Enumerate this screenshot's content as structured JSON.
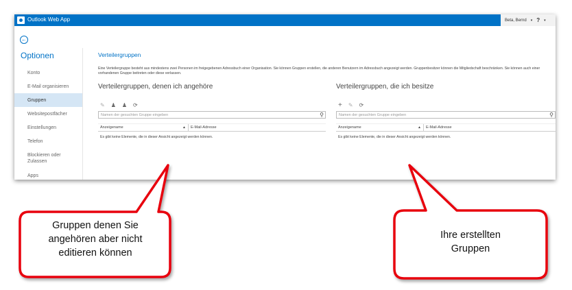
{
  "header": {
    "app_title": "Outlook Web App",
    "user_name": "Beta, Bernd",
    "user_caret": "▾",
    "help": "?",
    "help_caret": "▾"
  },
  "nav": {
    "back_icon": "back-arrow-icon",
    "title": "Optionen",
    "items": [
      {
        "label": "Konto"
      },
      {
        "label": "E-Mail organisieren"
      },
      {
        "label": "Gruppen"
      },
      {
        "label": "Websitepostfächer"
      },
      {
        "label": "Einstellungen"
      },
      {
        "label": "Telefon"
      },
      {
        "label": "Blockieren oder Zulassen"
      },
      {
        "label": "Apps"
      }
    ],
    "active": "Gruppen"
  },
  "content": {
    "title": "Verteilergruppen",
    "description": "Eine Verteilergruppe besteht aus mindestens zwei Personen im freigegebenen Adressbuch einer Organisation. Sie können Gruppen erstellen, die anderen Benutzern im Adressbuch angezeigt werden. Gruppenbesitzer können die Mitgliedschaft beschränken. Sie können auch einer vorhandenen Gruppe beitreten oder diese verlassen.",
    "member_section": {
      "title": "Verteilergruppen, denen ich angehöre",
      "search_placeholder": "Namen der gesuchten Gruppe eingeben",
      "col_display_name": "Anzeigename",
      "col_email": "E-Mail-Adresse",
      "empty_message": "Es gibt keine Elemente, die in dieser Ansicht angezeigt werden können."
    },
    "owner_section": {
      "title": "Verteilergruppen, die ich besitze",
      "search_placeholder": "Namen der gesuchten Gruppe eingeben",
      "col_display_name": "Anzeigename",
      "col_email": "E-Mail-Adresse",
      "empty_message": "Es gibt keine Elemente, die in dieser Ansicht angezeigt werden können."
    }
  },
  "callouts": {
    "left": "Gruppen denen Sie angehören aber nicht editieren können",
    "right": "Ihre erstellten Gruppen"
  },
  "colors": {
    "brand": "#0072c6",
    "callout_border": "#e8000d",
    "active_nav": "#d5e6f5"
  }
}
